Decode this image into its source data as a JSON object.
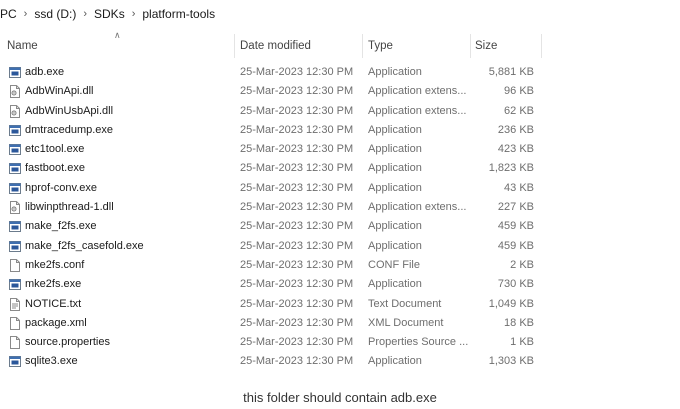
{
  "breadcrumb": [
    "PC",
    "ssd (D:)",
    "SDKs",
    "platform-tools"
  ],
  "columns": {
    "name": "Name",
    "date": "Date modified",
    "type": "Type",
    "size": "Size"
  },
  "files": [
    {
      "name": "adb.exe",
      "date": "25-Mar-2023 12:30 PM",
      "type": "Application",
      "size": "5,881 KB",
      "icon": "exe-icon"
    },
    {
      "name": "AdbWinApi.dll",
      "date": "25-Mar-2023 12:30 PM",
      "type": "Application extens...",
      "size": "96 KB",
      "icon": "dll-icon"
    },
    {
      "name": "AdbWinUsbApi.dll",
      "date": "25-Mar-2023 12:30 PM",
      "type": "Application extens...",
      "size": "62 KB",
      "icon": "dll-icon"
    },
    {
      "name": "dmtracedump.exe",
      "date": "25-Mar-2023 12:30 PM",
      "type": "Application",
      "size": "236 KB",
      "icon": "exe-icon"
    },
    {
      "name": "etc1tool.exe",
      "date": "25-Mar-2023 12:30 PM",
      "type": "Application",
      "size": "423 KB",
      "icon": "exe-icon"
    },
    {
      "name": "fastboot.exe",
      "date": "25-Mar-2023 12:30 PM",
      "type": "Application",
      "size": "1,823 KB",
      "icon": "exe-icon"
    },
    {
      "name": "hprof-conv.exe",
      "date": "25-Mar-2023 12:30 PM",
      "type": "Application",
      "size": "43 KB",
      "icon": "exe-icon"
    },
    {
      "name": "libwinpthread-1.dll",
      "date": "25-Mar-2023 12:30 PM",
      "type": "Application extens...",
      "size": "227 KB",
      "icon": "dll-icon"
    },
    {
      "name": "make_f2fs.exe",
      "date": "25-Mar-2023 12:30 PM",
      "type": "Application",
      "size": "459 KB",
      "icon": "exe-icon"
    },
    {
      "name": "make_f2fs_casefold.exe",
      "date": "25-Mar-2023 12:30 PM",
      "type": "Application",
      "size": "459 KB",
      "icon": "exe-icon"
    },
    {
      "name": "mke2fs.conf",
      "date": "25-Mar-2023 12:30 PM",
      "type": "CONF File",
      "size": "2 KB",
      "icon": "file-icon"
    },
    {
      "name": "mke2fs.exe",
      "date": "25-Mar-2023 12:30 PM",
      "type": "Application",
      "size": "730 KB",
      "icon": "exe-icon"
    },
    {
      "name": "NOTICE.txt",
      "date": "25-Mar-2023 12:30 PM",
      "type": "Text Document",
      "size": "1,049 KB",
      "icon": "text-file-icon"
    },
    {
      "name": "package.xml",
      "date": "25-Mar-2023 12:30 PM",
      "type": "XML Document",
      "size": "18 KB",
      "icon": "file-icon"
    },
    {
      "name": "source.properties",
      "date": "25-Mar-2023 12:30 PM",
      "type": "Properties Source ...",
      "size": "1 KB",
      "icon": "file-icon"
    },
    {
      "name": "sqlite3.exe",
      "date": "25-Mar-2023 12:30 PM",
      "type": "Application",
      "size": "1,303 KB",
      "icon": "exe-icon"
    }
  ],
  "caption": "this folder should contain adb.exe"
}
